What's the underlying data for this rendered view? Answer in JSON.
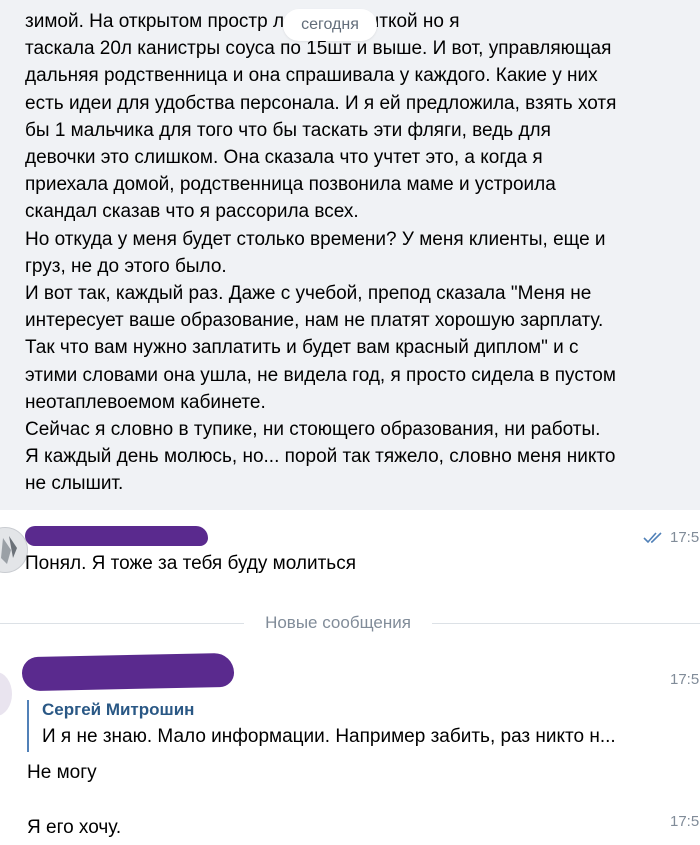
{
  "date_separator": "сегодня",
  "message1": {
    "lines": [
      "зимой. На открытом простр               ла официанткой но я",
      "таскала 20л канистры соуса по 15шт и выше. И вот, управляющая",
      "дальняя родственница и она спрашивала у каждого. Какие у них",
      "есть идеи для удобства персонала. И я ей предложила, взять хотя",
      "бы 1 мальчика для того что бы таскать эти фляги, ведь для",
      "девочки это слишком. Она сказала что учтет это, а когда я",
      "приехала домой, родственница позвонила маме и устроила",
      "скандал сказав что я рассорила всех.",
      "Но откуда у меня будет столько времени? У меня клиенты, еще и",
      "груз, не до этого было.",
      "И вот так, каждый раз. Даже с учебой, препод сказала \"Меня не",
      "интересует ваше образование, нам не платят хорошую зарплату.",
      "Так что вам нужно заплатить и будет вам красный диплом\" и с",
      "этими словами она ушла, не видела год, я просто сидела в пустом",
      "неотаплевоемом кабинете.",
      "Сейчас я словно в тупике, ни стоющего образования, ни работы.",
      "Я каждый день молюсь, но... порой так тяжело, словно меня никто",
      "не слышит."
    ]
  },
  "message2": {
    "text": "Понял. Я тоже за тебя буду молиться",
    "time": "17:5",
    "read_status_icon": "double-check-icon"
  },
  "new_messages_label": "Новые сообщения",
  "message3": {
    "time": "17:5",
    "reply": {
      "author": "Сергей Митрошин",
      "text": "И я не знаю. Мало информации. Например забить, раз никто н..."
    },
    "text": "Не могу"
  },
  "message4": {
    "text": "Я его хочу.",
    "time": "17:5"
  },
  "colors": {
    "highlight_bg": "#f0f2f5",
    "link_blue": "#2a5885",
    "meta_gray": "#818c99",
    "scribble_purple": "#5a2a8e"
  }
}
